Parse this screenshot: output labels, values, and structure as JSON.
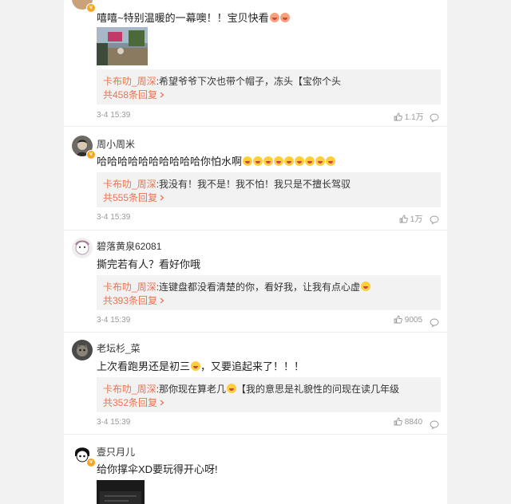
{
  "comments": [
    {
      "username": "",
      "text": "嘻嘻~特别温暖的一幕噢！！宝贝快看",
      "reply": {
        "author": "卡布叻_周深",
        "text": ":希望爷爷下次也带个帽子，冻头【宝你个头",
        "count": "共458条回复"
      },
      "time": "3-4 15:39",
      "likes": "1.1万"
    },
    {
      "username": "周小周米",
      "text": "哈哈哈哈哈哈哈哈哈哈你怕水啊",
      "reply": {
        "author": "卡布叻_周深",
        "text": ":我没有！我不是！我不怕！我只是不擅长驾驭",
        "count": "共555条回复"
      },
      "time": "3-4 15:39",
      "likes": "1万"
    },
    {
      "username": "碧落黄泉62081",
      "text": "撕完若有人？看好你哦",
      "reply": {
        "author": "卡布叻_周深",
        "text": ":连键盘都没看清楚的你，看好我，让我有点心虚",
        "count": "共393条回复"
      },
      "time": "3-4 15:39",
      "likes": "9005"
    },
    {
      "username": "老坛杉_菜",
      "text": "上次看跑男还是初三",
      "text_suffix": "，又要追起来了！！！",
      "reply": {
        "author": "卡布叻_周深",
        "text": ":那你现在算老几",
        "text_suffix": "【我的意思是礼貌性的问现在读几年级",
        "count": "共352条回复"
      },
      "time": "3-4 15:39",
      "likes": "8840"
    },
    {
      "username": "壹只月儿",
      "text": "给你撑伞XD要玩得开心呀!"
    }
  ],
  "colors": {
    "accent": "#eb7350",
    "badge": "#f5a623",
    "reply_bg": "#f2f2f2"
  },
  "icons": {
    "like": "thumbs-up-icon",
    "comment": "comment-bubble-icon",
    "more_replies": "chevron-right-icon"
  }
}
